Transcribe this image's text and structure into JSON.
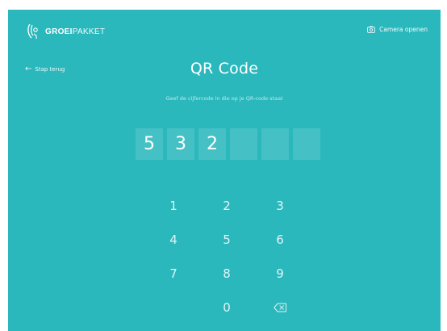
{
  "header": {
    "brand_bold": "GROEI",
    "brand_thin": "PAKKET",
    "camera_label": "Camera openen"
  },
  "nav": {
    "back_label": "Stap terug"
  },
  "main": {
    "title": "QR Code",
    "subtitle": "Geef de cijfercode in die op je QR-code staat",
    "code_digits": [
      "5",
      "3",
      "2",
      "",
      "",
      ""
    ]
  },
  "keypad": {
    "keys": [
      "1",
      "2",
      "3",
      "4",
      "5",
      "6",
      "7",
      "8",
      "9",
      "",
      "0"
    ],
    "backspace_icon": "backspace-icon"
  },
  "colors": {
    "background": "#2ab8bd",
    "text": "#ffffff"
  }
}
